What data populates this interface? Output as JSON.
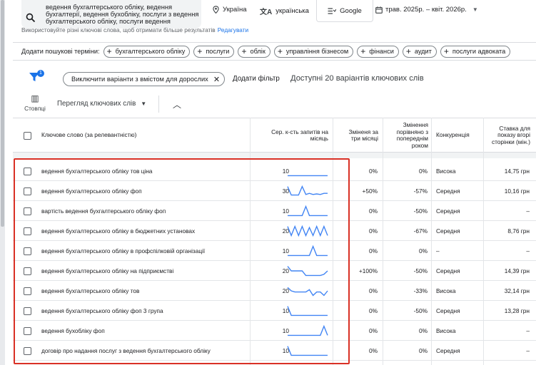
{
  "header": {
    "seed_keywords": "ведення бухгалтерського обліку, ведення бухгалтерії, ведення бухобліку, послуги з ведення бухгалтерського обліку, послуги ведення",
    "location": "Україна",
    "language": "українська",
    "network": "Google",
    "date_range": "трав. 2025р. – квіт. 2026р.",
    "hint_text": "Використовуйте різні ключові слова, щоб отримати більше результатів",
    "hint_link": "Редагувати"
  },
  "suggestions": {
    "label": "Додати пошукові терміни:",
    "chips": [
      "бухгалтерського обліку",
      "послуги",
      "облік",
      "управління бізнесом",
      "фінанси",
      "аудит",
      "послуги адвоката"
    ]
  },
  "filters": {
    "badge_count": "1",
    "adult_filter_chip": "Виключити варіанти з вмістом для дорослих",
    "add_filter": "Додати фільтр",
    "available_text": "Доступні 20 варіантів ключових слів"
  },
  "view": {
    "columns_label": "Стовпці",
    "view_select": "Перегляд ключових слів"
  },
  "table": {
    "headers": {
      "keyword": "Ключове слово (за релевантністю)",
      "avg_searches": "Сер. к-сть запитів на місяць",
      "three_month_change": "Зміненя за три місяці",
      "yoy_change": "Змінення порівняно з попереднім роком",
      "competition": "Конкуренція",
      "bid": "Ставка для показу вгорі сторінки (мін.)"
    },
    "rows": [
      {
        "keyword": "ведення бухгалтерського обліку тов ціна",
        "avg": "10",
        "three_month": "0%",
        "yoy": "0%",
        "competition": "Висока",
        "bid": "14,75 грн",
        "trend": [
          0.9,
          0.9,
          0.9,
          0.9,
          0.9,
          0.9,
          0.9,
          0.9,
          0.9,
          0.9,
          0.9,
          0.9
        ]
      },
      {
        "keyword": "ведення бухгалтерського обліку фоп",
        "avg": "30",
        "three_month": "+50%",
        "yoy": "-57%",
        "competition": "Середня",
        "bid": "10,16 грн",
        "trend": [
          0.1,
          0.85,
          0.85,
          0.85,
          0.1,
          0.8,
          0.7,
          0.8,
          0.75,
          0.8,
          0.7,
          0.7
        ]
      },
      {
        "keyword": "вартість ведення бухгалтерського обліку фоп",
        "avg": "10",
        "three_month": "0%",
        "yoy": "-50%",
        "competition": "Середня",
        "bid": "–",
        "trend": [
          0.9,
          0.9,
          0.9,
          0.9,
          0.9,
          0.1,
          0.9,
          0.9,
          0.9,
          0.9,
          0.9,
          0.9
        ]
      },
      {
        "keyword": "ведення бухгалтерського обліку в бюджетних установах",
        "avg": "20",
        "three_month": "0%",
        "yoy": "-67%",
        "competition": "Середня",
        "bid": "8,76 грн",
        "trend": [
          0.1,
          0.9,
          0.1,
          0.9,
          0.1,
          0.9,
          0.2,
          0.9,
          0.1,
          0.9,
          0.1,
          0.9
        ]
      },
      {
        "keyword": "ведення бухгалтерського обліку в профспілковій організації",
        "avg": "10",
        "three_month": "0%",
        "yoy": "0%",
        "competition": "–",
        "bid": "–",
        "trend": [
          0.9,
          0.9,
          0.9,
          0.9,
          0.9,
          0.9,
          0.9,
          0.1,
          0.9,
          0.9,
          0.9,
          0.9
        ]
      },
      {
        "keyword": "ведення бухгалтерського обліку на підприємстві",
        "avg": "20",
        "three_month": "+100%",
        "yoy": "-50%",
        "competition": "Середня",
        "bid": "14,39 грн",
        "trend": [
          0.1,
          0.5,
          0.5,
          0.5,
          0.5,
          0.9,
          0.9,
          0.9,
          0.9,
          0.9,
          0.8,
          0.5
        ]
      },
      {
        "keyword": "ведення бухгалтерського обліку тов",
        "avg": "20",
        "three_month": "0%",
        "yoy": "-33%",
        "competition": "Висока",
        "bid": "32,14 грн",
        "trend": [
          0.2,
          0.5,
          0.6,
          0.6,
          0.6,
          0.6,
          0.4,
          0.9,
          0.6,
          0.6,
          0.9,
          0.5
        ]
      },
      {
        "keyword": "ведення бухгалтерського обліку фоп 3 група",
        "avg": "10",
        "three_month": "0%",
        "yoy": "-50%",
        "competition": "Середня",
        "bid": "13,28 грн",
        "trend": [
          0.1,
          0.9,
          0.9,
          0.9,
          0.9,
          0.9,
          0.9,
          0.9,
          0.9,
          0.9,
          0.9,
          0.9
        ]
      },
      {
        "keyword": "ведення бухобліку фоп",
        "avg": "10",
        "three_month": "0%",
        "yoy": "0%",
        "competition": "Висока",
        "bid": "–",
        "trend": [
          0.9,
          0.9,
          0.9,
          0.9,
          0.9,
          0.9,
          0.9,
          0.9,
          0.9,
          0.9,
          0.1,
          0.9
        ]
      },
      {
        "keyword": "договір про надання послуг з ведення бухгалтерського обліку",
        "avg": "10",
        "three_month": "0%",
        "yoy": "0%",
        "competition": "Середня",
        "bid": "–",
        "trend": [
          0.1,
          0.9,
          0.9,
          0.9,
          0.9,
          0.9,
          0.9,
          0.9,
          0.9,
          0.9,
          0.9,
          0.9
        ]
      }
    ]
  },
  "colors": {
    "accent": "#1a73e8",
    "trend_line": "#4285f4",
    "highlight_box": "#d93025"
  }
}
